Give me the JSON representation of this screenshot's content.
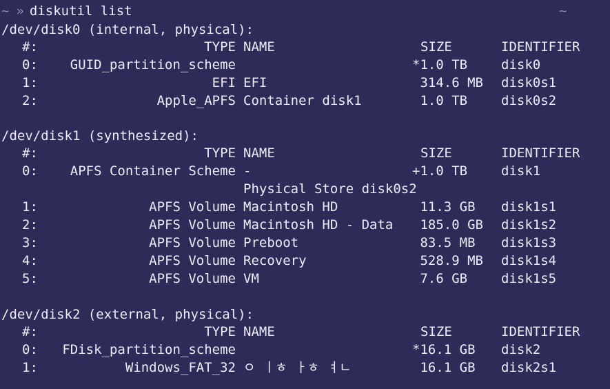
{
  "prompt": {
    "symbol": "~",
    "arrow": "»",
    "command": "diskutil list",
    "right_indicator": "~"
  },
  "columns": {
    "num": "#:",
    "type": "TYPE",
    "name": "NAME",
    "size": "SIZE",
    "identifier": "IDENTIFIER"
  },
  "disks": [
    {
      "header": "/dev/disk0 (internal, physical):",
      "rows": [
        {
          "num": "0:",
          "type": "GUID_partition_scheme",
          "name": "",
          "size": "*1.0 TB",
          "id": "disk0"
        },
        {
          "num": "1:",
          "type": "EFI",
          "name": "EFI",
          "size": " 314.6 MB",
          "id": "disk0s1"
        },
        {
          "num": "2:",
          "type": "Apple_APFS",
          "name": "Container disk1",
          "size": " 1.0 TB",
          "id": "disk0s2"
        }
      ]
    },
    {
      "header": "/dev/disk1 (synthesized):",
      "rows": [
        {
          "num": "0:",
          "type": "APFS Container Scheme",
          "name": "-",
          "size": "+1.0 TB",
          "id": "disk1"
        },
        {
          "num": "",
          "type": "",
          "name": "Physical Store disk0s2",
          "size": "",
          "id": ""
        },
        {
          "num": "1:",
          "type": "APFS Volume",
          "name": "Macintosh HD",
          "size": " 11.3 GB",
          "id": "disk1s1"
        },
        {
          "num": "2:",
          "type": "APFS Volume",
          "name": "Macintosh HD - Data",
          "size": " 185.0 GB",
          "id": "disk1s2"
        },
        {
          "num": "3:",
          "type": "APFS Volume",
          "name": "Preboot",
          "size": " 83.5 MB",
          "id": "disk1s3"
        },
        {
          "num": "4:",
          "type": "APFS Volume",
          "name": "Recovery",
          "size": " 528.9 MB",
          "id": "disk1s4"
        },
        {
          "num": "5:",
          "type": "APFS Volume",
          "name": "VM",
          "size": " 7.6 GB",
          "id": "disk1s5"
        }
      ]
    },
    {
      "header": "/dev/disk2 (external, physical):",
      "rows": [
        {
          "num": "0:",
          "type": "FDisk_partition_scheme",
          "name": "",
          "size": "*16.1 GB",
          "id": "disk2"
        },
        {
          "num": "1:",
          "type": "Windows_FAT_32",
          "name": "ㅇ ㅣㅎ ㅏㅎ ㅕㄴ",
          "size": " 16.1 GB",
          "id": "disk2s1"
        }
      ]
    }
  ]
}
